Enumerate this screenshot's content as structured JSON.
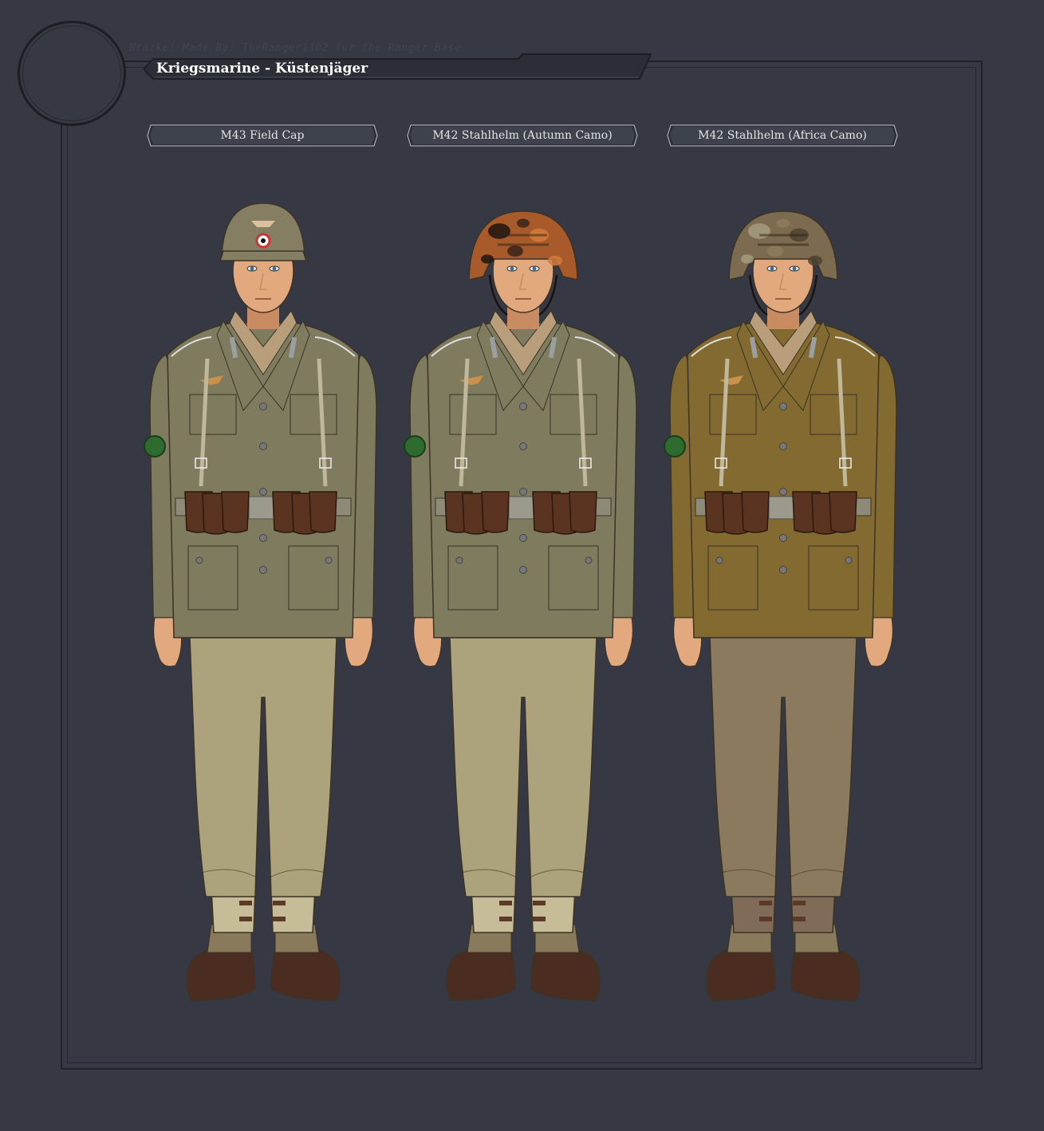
{
  "credit": "Bracket Made By: TheRanger1302 for the Ranger Base",
  "title": "Kriegsmarine - Küstenjäger",
  "figures": [
    {
      "label": "M43 Field Cap",
      "headgear": "field-cap",
      "colors": {
        "headgear": "#857e62",
        "tunic": "#7f7b5f",
        "trousers": "#aca27c",
        "gaiters": "#c7bc98"
      }
    },
    {
      "label": "M42 Stahlhelm (Autumn Camo)",
      "headgear": "helmet-autumn-camo",
      "colors": {
        "headgear": "#a95a2a",
        "tunic": "#7f7b5f",
        "trousers": "#aca27c",
        "gaiters": "#c7bc98"
      }
    },
    {
      "label": "M42 Stahlhelm (Africa Camo)",
      "headgear": "helmet-africa-camo",
      "colors": {
        "headgear": "#7c6b4e",
        "tunic": "#826a30",
        "trousers": "#8c7a5e",
        "gaiters": "#7f6b58"
      }
    }
  ]
}
